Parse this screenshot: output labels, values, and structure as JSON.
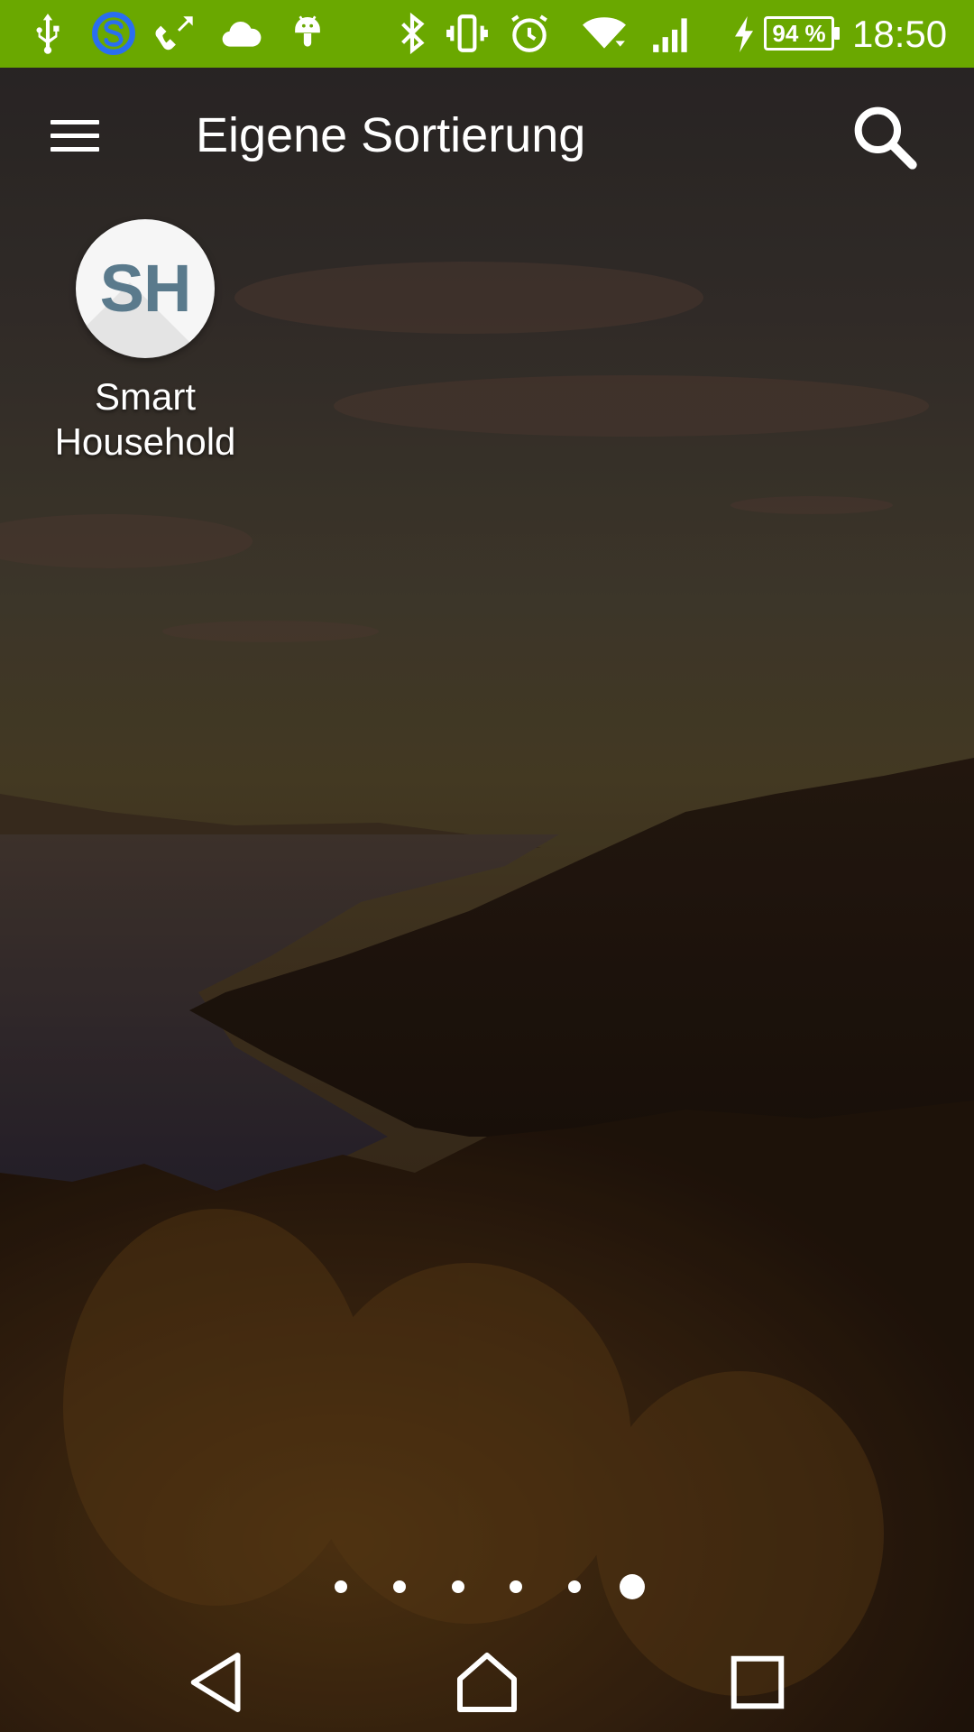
{
  "status_bar": {
    "icons": [
      "usb-icon",
      "sync-app-icon",
      "phone-icon",
      "cloud-icon",
      "android-debug-icon",
      "bluetooth-icon",
      "vibrate-icon",
      "alarm-icon",
      "wifi-icon",
      "signal-icon",
      "charging-icon"
    ],
    "battery": "94 %",
    "time": "18:50",
    "background_color": "#6aa800"
  },
  "toolbar": {
    "title": "Eigene Sortierung",
    "menu_icon": "hamburger-menu-icon",
    "search_icon": "search-icon"
  },
  "apps": [
    {
      "initials": "SH",
      "label_line1": "Smart",
      "label_line2": "Household"
    }
  ],
  "page_indicator": {
    "count": 6,
    "active_index": 5
  },
  "nav_bar": {
    "buttons": [
      "back-icon",
      "home-icon",
      "recents-icon"
    ]
  }
}
